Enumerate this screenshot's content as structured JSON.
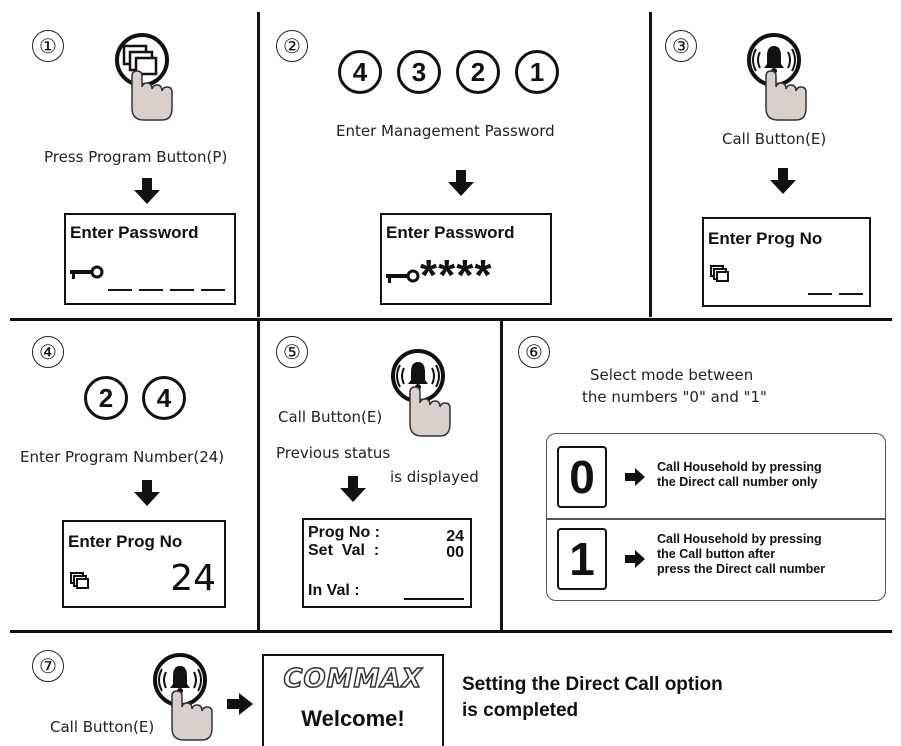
{
  "steps": [
    "①",
    "②",
    "③",
    "④",
    "⑤",
    "⑥",
    "⑦"
  ],
  "panel1": {
    "caption": "Press Program Button(P)",
    "lcd_title": "Enter Password"
  },
  "panel2": {
    "digits": [
      "4",
      "3",
      "2",
      "1"
    ],
    "caption": "Enter Management Password",
    "lcd_title": "Enter Password",
    "stars": "****"
  },
  "panel3": {
    "caption": "Call Button(E)",
    "lcd_title": "Enter Prog  No"
  },
  "panel4": {
    "digits": [
      "2",
      "4"
    ],
    "caption": "Enter Program Number(24)",
    "lcd_title": "Enter Prog  No",
    "value": "24"
  },
  "panel5": {
    "caption": "Call Button(E)",
    "note_line1": "Previous status",
    "note_line2": "is displayed",
    "lcd_row1_label": "Prog No :",
    "lcd_row1_value": "24",
    "lcd_row2_label": "Set  Val  :",
    "lcd_row2_value": "00",
    "lcd_row3_label": "In Val :"
  },
  "panel6": {
    "caption_line1": "Select mode  between",
    "caption_line2": "the numbers \"0\" and \"1\"",
    "mode0_digit": "0",
    "mode0_text": "Call Household by pressing\nthe Direct call number only",
    "mode1_digit": "1",
    "mode1_text": "Call Household by pressing\nthe Call button after\npress the Direct call number"
  },
  "panel7": {
    "caption": "Call Button(E)",
    "logo": "COMMAX",
    "welcome": "Welcome!",
    "result_line1": "Setting the Direct Call option",
    "result_line2": "is completed"
  }
}
